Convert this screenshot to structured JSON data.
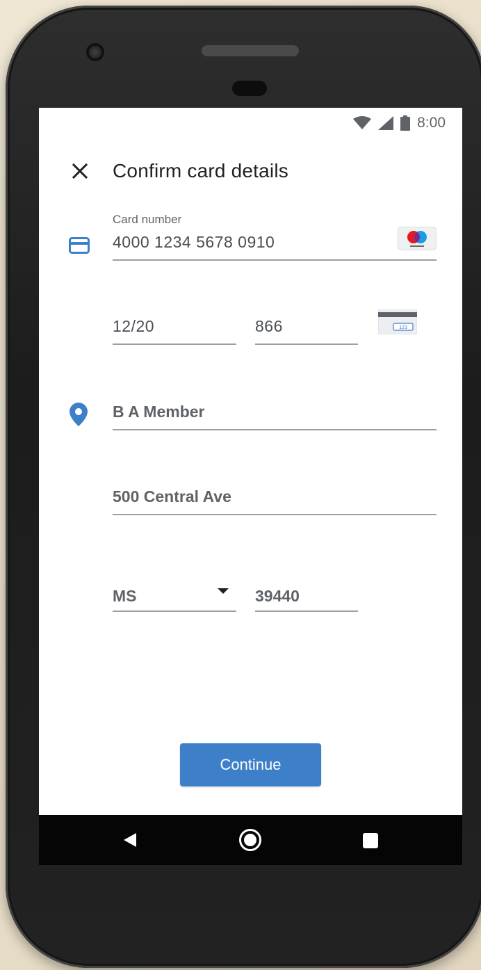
{
  "status_bar": {
    "time": "8:00",
    "icons": [
      "wifi-icon",
      "cell-signal-icon",
      "battery-icon"
    ]
  },
  "app_bar": {
    "title": "Confirm card details",
    "close_icon": "close-icon"
  },
  "card": {
    "number_label": "Card number",
    "number_value": "4000 1234 5678 0910",
    "expiry_value": "12/20",
    "cvv_value": "866",
    "brand_icon": "maestro-card-logo",
    "cvv_hint_icon": "card-back-cvv-icon"
  },
  "address": {
    "name_value": "B A Member",
    "street_value": "500 Central Ave",
    "state_value": "MS",
    "zip_value": "39440"
  },
  "actions": {
    "continue_label": "Continue"
  },
  "nav_bar": {
    "icons": [
      "back-icon",
      "home-icon",
      "recents-icon"
    ]
  },
  "colors": {
    "accent": "#3d7fc9",
    "icon_blue": "#3d7fc9",
    "text_secondary": "#5f6368",
    "underline": "#9aa0a6"
  }
}
